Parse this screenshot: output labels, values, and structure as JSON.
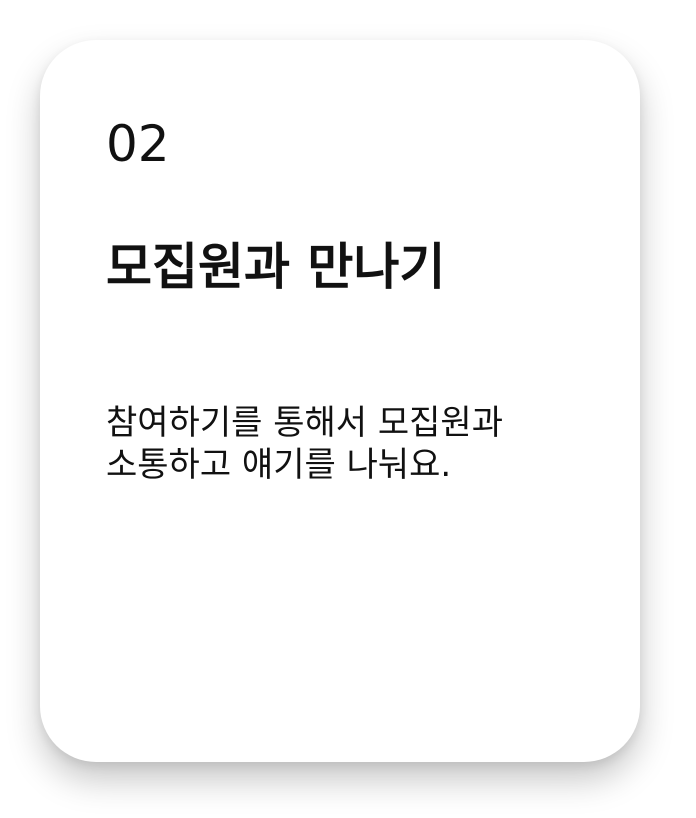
{
  "card": {
    "step_number": "02",
    "title": "모집원과 만나기",
    "description_lines": [
      "참여하기를 통해서 모집원과",
      "소통하고 얘기를 나눠요."
    ]
  }
}
